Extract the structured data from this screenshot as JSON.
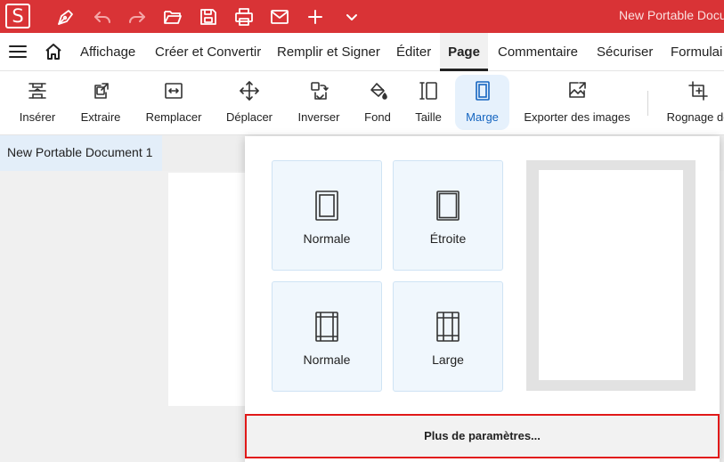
{
  "app": {
    "logo_letter": "S",
    "document_title": "New Portable Docu",
    "accent_color": "#d93336"
  },
  "quick_access": [
    "pen-icon",
    "undo-icon",
    "redo-icon",
    "open-folder-icon",
    "save-icon",
    "print-icon",
    "email-icon",
    "new-plus-icon",
    "more-chevron-icon"
  ],
  "menu": {
    "items": [
      "Affichage",
      "Créer et Convertir",
      "Remplir et Signer",
      "Éditer",
      "Page",
      "Commentaire",
      "Sécuriser",
      "Formulai"
    ],
    "active": "Page"
  },
  "toolbar": {
    "tools": [
      {
        "label": "Insérer",
        "icon": "insert-page-icon"
      },
      {
        "label": "Extraire",
        "icon": "extract-icon"
      },
      {
        "label": "Remplacer",
        "icon": "replace-icon"
      },
      {
        "label": "Déplacer",
        "icon": "move-icon"
      },
      {
        "label": "Inverser",
        "icon": "reverse-icon"
      },
      {
        "label": "Fond",
        "icon": "background-fill-icon"
      },
      {
        "label": "Taille",
        "icon": "size-icon"
      },
      {
        "label": "Marge",
        "icon": "margin-icon"
      },
      {
        "label": "Exporter des images",
        "icon": "export-images-icon"
      },
      {
        "label": "Rognage de",
        "icon": "crop-icon"
      }
    ],
    "active": "Marge"
  },
  "document_tab": {
    "label": "New Portable Document 1"
  },
  "margin_panel": {
    "options": [
      "Normale",
      "Étroite",
      "Normale",
      "Large"
    ],
    "more_button": "Plus de paramètres..."
  }
}
